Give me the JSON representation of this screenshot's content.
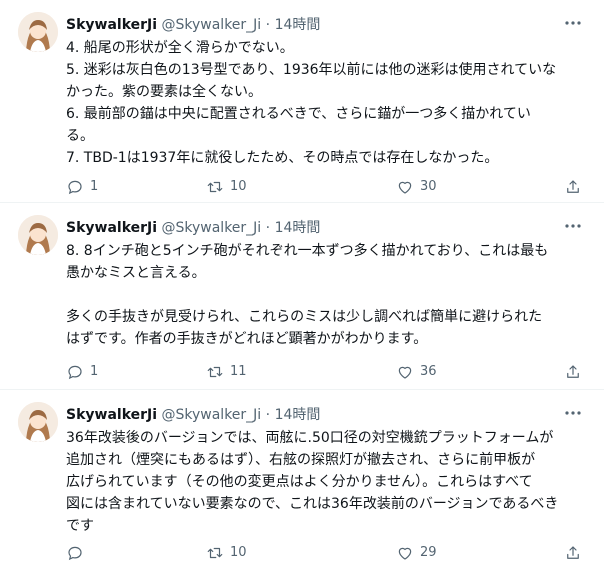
{
  "tweets": [
    {
      "display_name": "SkywalkerJi",
      "handle": "@Skywalker_Ji",
      "separator": "·",
      "time": "14時間",
      "lines": [
        "4. 船尾の形状が全く滑らかでない。",
        "5. 迷彩は灰白色の13号型であり、1936年以前には他の迷彩は使用されていな",
        "かった。紫の要素は全くない。",
        "6. 最前部の錨は中央に配置されるべきで、さらに錨が一つ多く描かれてい",
        "る。",
        "7. TBD-1は1937年に就役したため、その時点では存在しなかった。"
      ],
      "replies": "1",
      "retweets": "10",
      "likes": "30"
    },
    {
      "display_name": "SkywalkerJi",
      "handle": "@Skywalker_Ji",
      "separator": "·",
      "time": "14時間",
      "lines": [
        "8. 8インチ砲と5インチ砲がそれぞれ一本ずつ多く描かれており、これは最も",
        "愚かなミスと言える。",
        "",
        "多くの手抜きが見受けられ、これらのミスは少し調べれば簡単に避けられた",
        "はずです。作者の手抜きがどれほど顕著かがわかります。"
      ],
      "replies": "1",
      "retweets": "11",
      "likes": "36"
    },
    {
      "display_name": "SkywalkerJi",
      "handle": "@Skywalker_Ji",
      "separator": "·",
      "time": "14時間",
      "lines": [
        "36年改装後のバージョンでは、両舷に.50口径の対空機銃プラットフォームが",
        "追加され（煙突にもあるはず）、右舷の探照灯が撤去され、さらに前甲板が",
        "広げられています（その他の変更点はよく分かりません）。これらはすべて",
        "図には含まれていない要素なので、これは36年改装前のバージョンであるべき",
        "です"
      ],
      "replies": "",
      "retweets": "10",
      "likes": "29"
    }
  ],
  "colors": {
    "text": "#0f1419",
    "secondary": "#536471",
    "divider": "#eff3f4"
  },
  "icons": [
    "reply-icon",
    "retweet-icon",
    "like-icon",
    "share-icon",
    "more-icon"
  ]
}
